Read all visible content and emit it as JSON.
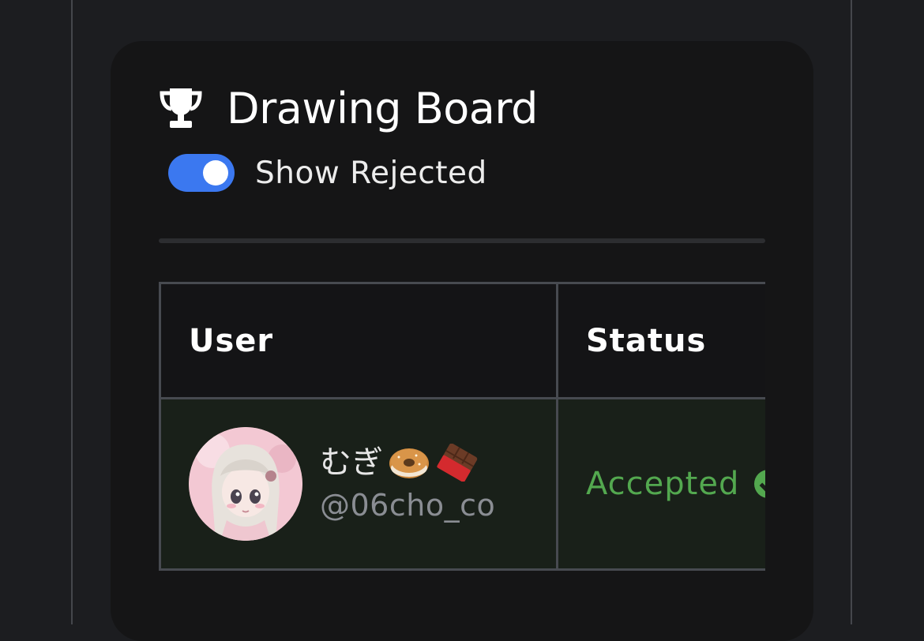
{
  "board": {
    "title": "Drawing Board",
    "icon": "trophy-icon",
    "show_rejected": {
      "label": "Show Rejected",
      "enabled": true
    }
  },
  "table": {
    "headers": {
      "user": "User",
      "status": "Status"
    },
    "rows": [
      {
        "display_name": "むぎ",
        "display_name_emoji": [
          "bagel-icon",
          "chocolate-bar-icon"
        ],
        "handle": "@06cho_co",
        "avatar": "anime-girl-avatar",
        "status": "Accepted",
        "status_icon": "check-circle-icon"
      }
    ]
  },
  "colors": {
    "background": "#1c1d20",
    "card": "#151516",
    "accent": "#3b78f0",
    "accepted": "#53a84f",
    "row_background": "#192019"
  }
}
